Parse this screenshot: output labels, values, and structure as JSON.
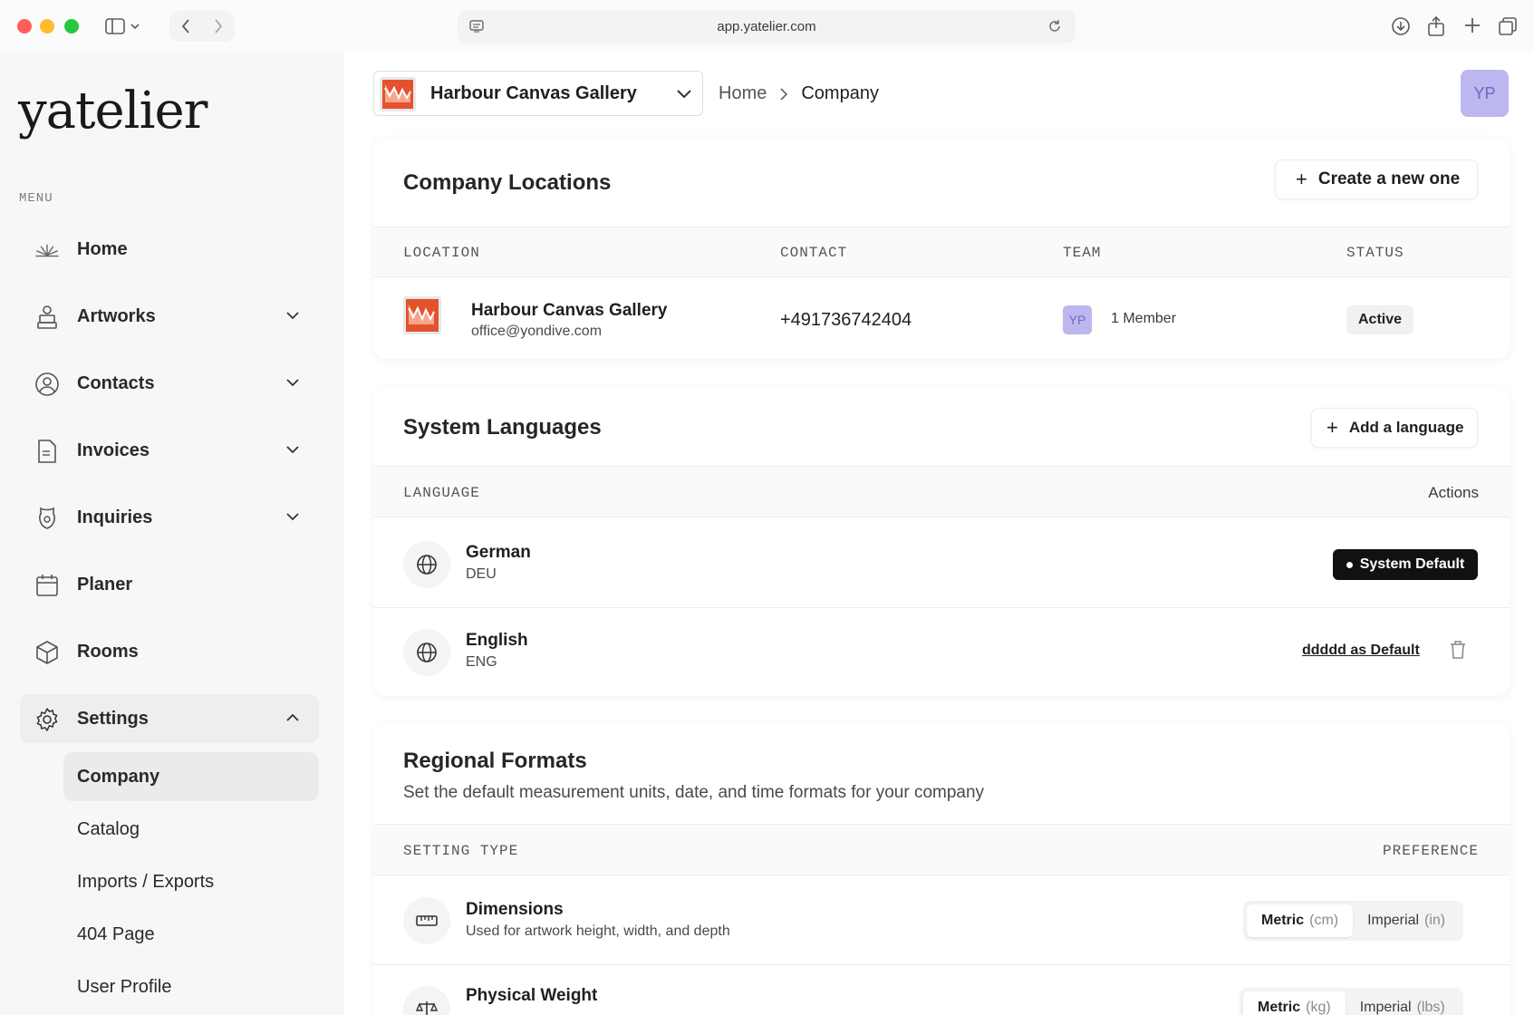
{
  "browser": {
    "url": "app.yatelier.com"
  },
  "sidebar": {
    "logo": "yatelier",
    "menu_label": "MENU",
    "items": [
      {
        "label": "Home",
        "icon": "home-burst-icon",
        "expandable": false
      },
      {
        "label": "Artworks",
        "icon": "easel-icon",
        "expandable": true
      },
      {
        "label": "Contacts",
        "icon": "user-circle-icon",
        "expandable": true
      },
      {
        "label": "Invoices",
        "icon": "document-icon",
        "expandable": true
      },
      {
        "label": "Inquiries",
        "icon": "inquiry-icon",
        "expandable": true
      },
      {
        "label": "Planer",
        "icon": "calendar-icon",
        "expandable": false
      },
      {
        "label": "Rooms",
        "icon": "cube-icon",
        "expandable": false
      },
      {
        "label": "Settings",
        "icon": "gear-icon",
        "expandable": true,
        "expanded": true
      }
    ],
    "settings_sub": [
      {
        "label": "Company",
        "selected": true
      },
      {
        "label": "Catalog"
      },
      {
        "label": "Imports / Exports"
      },
      {
        "label": "404 Page"
      },
      {
        "label": "User Profile"
      }
    ]
  },
  "topbar": {
    "company_name": "Harbour Canvas Gallery",
    "breadcrumb": [
      "Home",
      "Company"
    ],
    "avatar_initials": "YP"
  },
  "locations": {
    "title": "Company Locations",
    "create_label": "Create a new one",
    "columns": [
      "LOCATION",
      "CONTACT",
      "TEAM",
      "STATUS"
    ],
    "rows": [
      {
        "name": "Harbour Canvas Gallery",
        "email": "office@yondive.com",
        "contact": "+491736742404",
        "team_initials": "YP",
        "team_count": "1 Member",
        "status": "Active"
      }
    ]
  },
  "languages": {
    "title": "System Languages",
    "add_label": "Add a language",
    "col_language": "LANGUAGE",
    "col_actions": "Actions",
    "rows": [
      {
        "name": "German",
        "code": "DEU",
        "badge": "System Default"
      },
      {
        "name": "English",
        "code": "ENG",
        "action": "ddddd as Default"
      }
    ]
  },
  "regional": {
    "title": "Regional Formats",
    "subtitle": "Set the default measurement units, date, and time formats for your company",
    "col_setting": "SETTING TYPE",
    "col_pref": "PREFERENCE",
    "rows": [
      {
        "name": "Dimensions",
        "desc": "Used for artwork height, width, and depth",
        "opt1": "Metric",
        "opt1_unit": "(cm)",
        "opt2": "Imperial",
        "opt2_unit": "(in)"
      },
      {
        "name": "Physical Weight",
        "opt1": "Metric",
        "opt1_unit": "(kg)",
        "opt2": "Imperial",
        "opt2_unit": "(lbs)"
      }
    ]
  },
  "colors": {
    "avatar_bg": "#bdb7ef",
    "avatar_fg": "#6f69c4",
    "brand_logo": "#e2532d",
    "badge_dark": "#111111"
  }
}
